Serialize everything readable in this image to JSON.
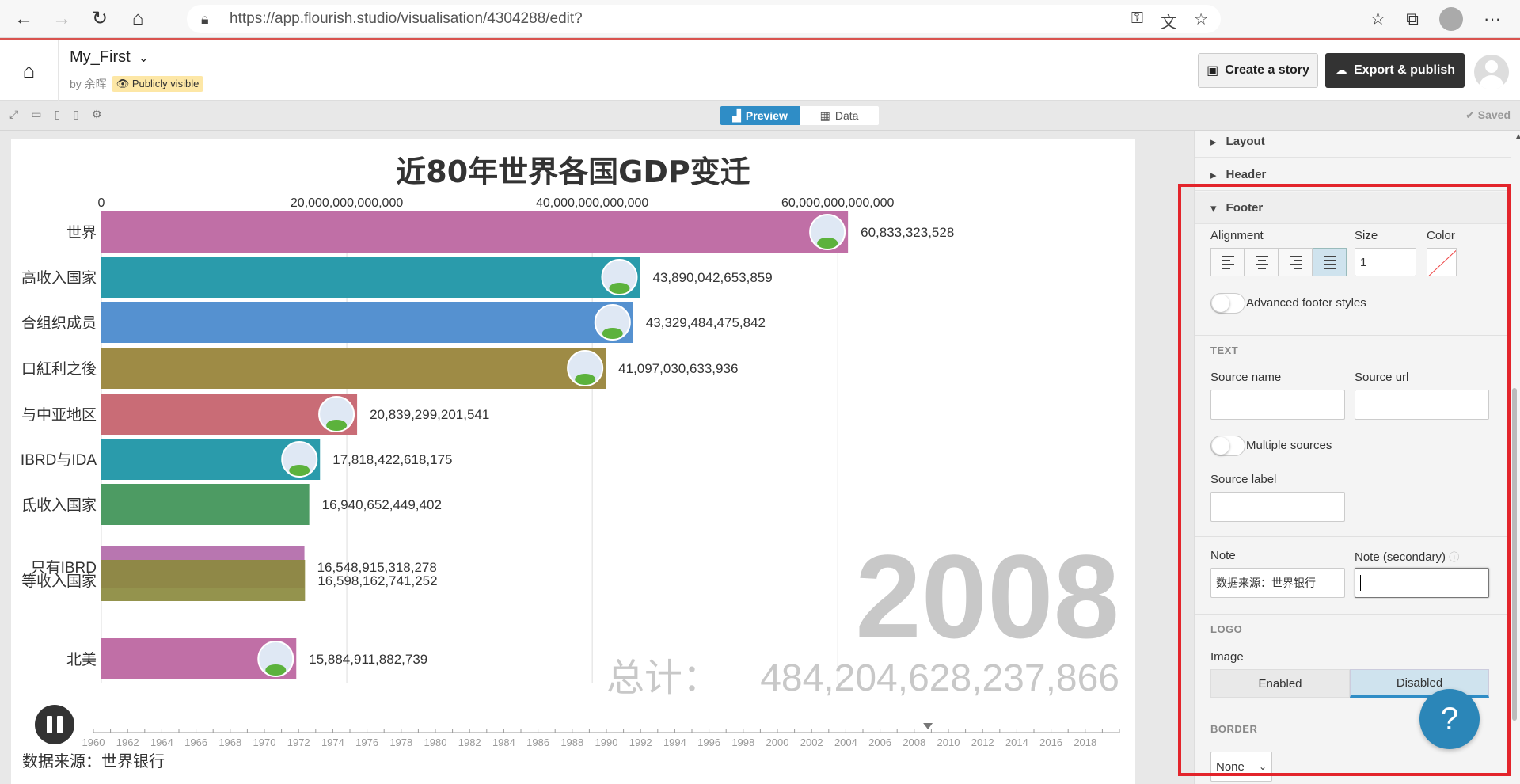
{
  "browser": {
    "url": "https://app.flourish.studio/visualisation/4304288/edit?"
  },
  "header": {
    "project_title": "My_First",
    "byline": "by 余晖",
    "visibility": "Publicly visible",
    "create_story": "Create a story",
    "export_publish": "Export & publish"
  },
  "toolbar": {
    "preview": "Preview",
    "data": "Data",
    "saved": "✔ Saved"
  },
  "chart_data": {
    "type": "bar",
    "title": "近80年世界各国GDP变迁",
    "x_ticks": [
      "0",
      "20,000,000,000,000",
      "40,000,000,000,000",
      "60,000,000,000,000"
    ],
    "xlim": [
      0,
      68500000000000
    ],
    "categories": [
      "世界",
      "高收入国家",
      "经合组织成员",
      "人口红利之後",
      "欧洲与中亚地区",
      "IBRD与IDA",
      "中低收入国家",
      "只有IBRD",
      "中等收入国家",
      "北美"
    ],
    "visible_labels": [
      "世界",
      "高收入国家",
      "合组织成员",
      "口紅利之後",
      "与中亚地区",
      "IBRD与IDA",
      "氐收入国家",
      "只有IBRD",
      "等收入国家",
      "北美"
    ],
    "values": [
      60833323528000,
      43890042653859,
      43329484475842,
      41097030633936,
      20839299201541,
      17818422618175,
      16940652449402,
      16548915318278,
      16598162741252,
      15884911882739
    ],
    "value_labels": [
      "60,833,323,528",
      "43,890,042,653,859",
      "43,329,484,475,842",
      "41,097,030,633,936",
      "20,839,299,201,541",
      "17,818,422,618,175",
      "16,940,652,449,402",
      "16,548,915,318,278",
      "16,598,162,741,252",
      "15,884,911,882,739"
    ],
    "colors": [
      "#c06fa6",
      "#2a9bab",
      "#5591d0",
      "#9e8b45",
      "#c96c76",
      "#2a9bab",
      "#4d9b63",
      "#b876b0",
      "#8b8a3e",
      "#c06fa6"
    ],
    "year": "2008",
    "total_label": "总计：",
    "total_value": "484,204,628,237,866",
    "timeline_years": [
      "1960",
      "1962",
      "1964",
      "1966",
      "1968",
      "1970",
      "1972",
      "1974",
      "1976",
      "1978",
      "1980",
      "1982",
      "1984",
      "1986",
      "1988",
      "1990",
      "1992",
      "1994",
      "1996",
      "1998",
      "2000",
      "2002",
      "2004",
      "2006",
      "2008",
      "2010",
      "2012",
      "2014",
      "2016",
      "2018"
    ],
    "timeline_current": 2008.8
  },
  "footer_note": "数据来源：世界银行",
  "sidebar": {
    "layout": "Layout",
    "header": "Header",
    "footer": "Footer",
    "alignment": "Alignment",
    "size": "Size",
    "size_value": "1",
    "color": "Color",
    "advanced_footer": "Advanced footer styles",
    "text_section": "TEXT",
    "source_name": "Source name",
    "source_url": "Source url",
    "multiple_sources": "Multiple sources",
    "source_label": "Source label",
    "note": "Note",
    "note_secondary": "Note (secondary)",
    "note_value": "数据来源：世界银行",
    "logo_section": "LOGO",
    "image": "Image",
    "enabled": "Enabled",
    "disabled": "Disabled",
    "border_section": "BORDER",
    "border_value": "None"
  }
}
